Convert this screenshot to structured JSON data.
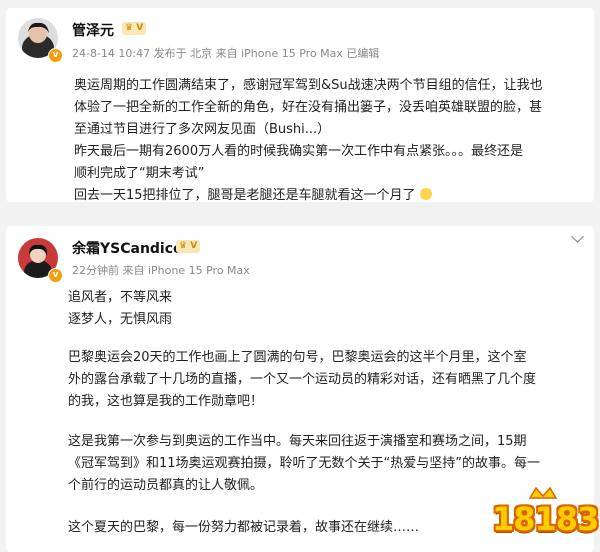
{
  "post1": {
    "username": "管泽元",
    "meta": "24-8-14 10:47 发布于 北京 来自 iPhone 15 Pro Max 已编辑",
    "lines": [
      "奥运周期的工作圆满结束了，感谢冠军驾到&Su战速决两个节目组的信任，让我也",
      "体验了一把全新的工作全新的角色，好在没有捅出篓子，没丢咱英雄联盟的脸，甚",
      "至通过节目进行了多次网友见面（Bushi...）",
      "昨天最后一期有2600万人看的时候我确实第一次工作中有点紧张。。。最终还是",
      "顺利完成了“期末考试”",
      "回去一天15把排位了，腿哥是老腿还是车腿就看这一个月了"
    ]
  },
  "post2": {
    "username": "余霜YSCandice",
    "meta": "22分钟前 来自 iPhone 15 Pro Max",
    "lines": [
      "追风者，不等风来",
      "逐梦人，无惧风雨",
      "巴黎奥运会20天的工作也画上了圆满的句号，巴黎奥运会的这半个月里，这个室",
      "外的露台承载了十几场的直播，一个又一个运动员的精彩对话，还有晒黑了几个度",
      "的我，这也算是我的工作勋章吧！",
      "这是我第一次参与到奥运的工作当中。每天来回往返于演播室和赛场之间，15期",
      "《冠军驾到》和11场奥运观赛拍摄，聆听了无数个关于“热爱与坚持”的故事。每一",
      "个前行的运动员都真的让人敬佩。",
      "这个夏天的巴黎，每一份努力都被记录着，故事还在继续……"
    ]
  },
  "watermark": "18183",
  "colors": {
    "vip_badge": "#f59d0c",
    "logo_fill": "#ffcc00",
    "logo_outline": "#d96400"
  }
}
